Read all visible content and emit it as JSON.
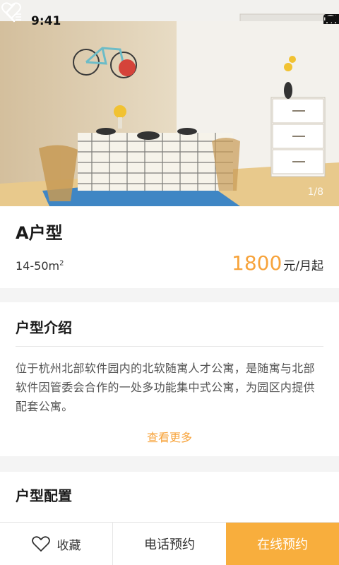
{
  "status_bar": {
    "time": "9:41"
  },
  "hero": {
    "photo_counter": "1/8"
  },
  "unit": {
    "title": "A户型",
    "area": "14-50m",
    "area_sup": "2",
    "price_value": "1800",
    "price_unit": "元/月起"
  },
  "intro": {
    "title": "户型介绍",
    "text": "位于杭州北部软件园内的北软随寓人才公寓，是随寓与北部软件因管委会合作的一处多功能集中式公寓，为园区内提供配套公寓。",
    "view_more": "查看更多"
  },
  "config": {
    "title": "户型配置"
  },
  "bottom_bar": {
    "favorite_label": "收藏",
    "phone_label": "电话预约",
    "online_label": "在线预约"
  },
  "colors": {
    "accent": "#f7a33b",
    "button_bg": "#f8ae3d"
  },
  "icons": [
    "back-arrow-icon",
    "favorite-list-icon",
    "heart-icon",
    "signal-icon",
    "wifi-icon",
    "battery-icon"
  ]
}
